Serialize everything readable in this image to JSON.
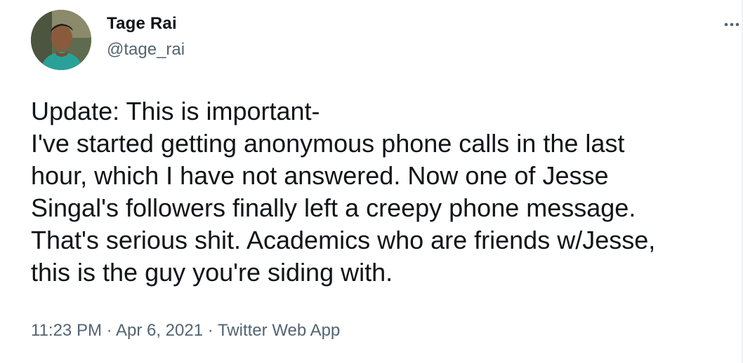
{
  "author": {
    "display_name": "Tage Rai",
    "handle": "@tage_rai"
  },
  "menu": {
    "icon": "more-horizontal-icon"
  },
  "tweet": {
    "lines": [
      "Update: This is important-",
      "I've started getting anonymous phone calls in the last",
      "hour, which I have not answered. Now one of Jesse",
      "Singal's followers finally left a creepy phone message.",
      "That's serious shit. Academics who are friends w/Jesse,",
      "this is the guy you're siding with."
    ]
  },
  "meta": {
    "time": "11:23 PM",
    "separator": " · ",
    "date": "Apr 6, 2021",
    "source": "Twitter Web App"
  },
  "colors": {
    "text": "#0f1419",
    "secondary": "#536471",
    "background": "#ffffff"
  }
}
